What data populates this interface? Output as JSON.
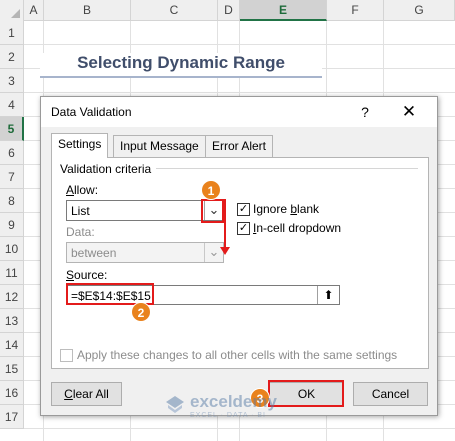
{
  "sheet": {
    "columns": [
      "A",
      "B",
      "C",
      "D",
      "E",
      "F",
      "G"
    ],
    "selected_column": "E",
    "rows": [
      "1",
      "2",
      "3",
      "4",
      "5",
      "6",
      "7",
      "8",
      "9",
      "10",
      "11",
      "12",
      "13",
      "14",
      "15",
      "16",
      "17"
    ],
    "selected_row": "5",
    "title": "Selecting Dynamic Range"
  },
  "dialog": {
    "title": "Data Validation",
    "help_label": "?",
    "close_label": "✕",
    "tabs": [
      {
        "label": "Settings",
        "active": true
      },
      {
        "label": "Input Message",
        "active": false
      },
      {
        "label": "Error Alert",
        "active": false
      }
    ],
    "criteria_heading": "Validation criteria",
    "allow_label": "Allow:",
    "allow_value": "List",
    "data_label": "Data:",
    "data_value": "between",
    "ignore_blank_label": "Ignore blank",
    "ignore_blank_checked": true,
    "in_cell_dropdown_label": "In-cell dropdown",
    "in_cell_dropdown_checked": true,
    "source_label": "Source:",
    "source_value": "=$E$14:$E$15",
    "apply_all_label": "Apply these changes to all other cells with the same settings",
    "apply_all_checked": false,
    "clear_all_label": "Clear All",
    "ok_label": "OK",
    "cancel_label": "Cancel"
  },
  "annotations": {
    "badges": [
      "1",
      "2",
      "3"
    ],
    "color": "#e31b1b",
    "badge_color": "#e9821d"
  },
  "watermark": {
    "name": "exceldemy",
    "tagline": "EXCEL · DATA · BI"
  },
  "icons": {
    "dropdown": "chevron-down-icon",
    "collapse": "collapse-dialog-icon",
    "check": "checkmark-icon"
  }
}
